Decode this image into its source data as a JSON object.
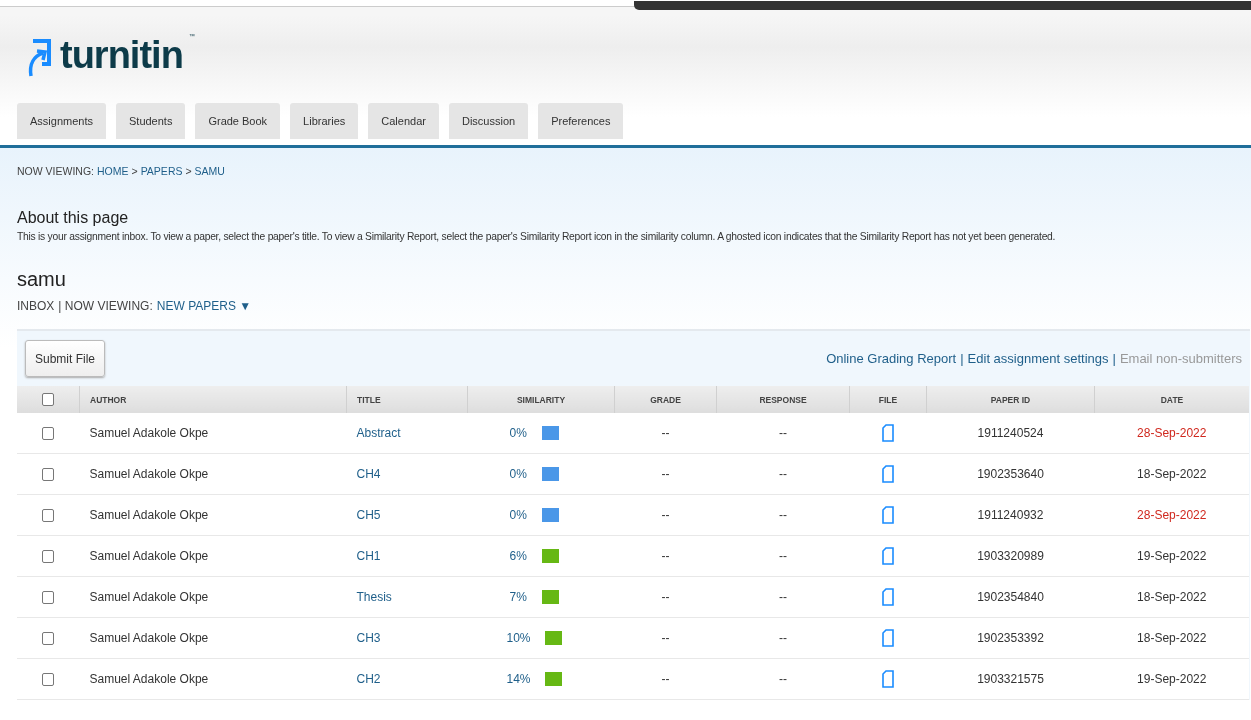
{
  "logo": {
    "text": "turnitin",
    "trademark": "™"
  },
  "tabs": [
    {
      "label": "Assignments",
      "selected": false
    },
    {
      "label": "Students",
      "selected": false
    },
    {
      "label": "Grade Book",
      "selected": false
    },
    {
      "label": "Libraries",
      "selected": false
    },
    {
      "label": "Calendar",
      "selected": false
    },
    {
      "label": "Discussion",
      "selected": false
    },
    {
      "label": "Preferences",
      "selected": false
    }
  ],
  "breadcrumb": {
    "prefix": "NOW VIEWING:",
    "links": [
      "HOME",
      "PAPERS",
      "SAMU"
    ],
    "separator": ">"
  },
  "about": {
    "heading": "About this page",
    "text": "This is your assignment inbox. To view a paper, select the paper's title. To view a Similarity Report, select the paper's Similarity Report icon in the similarity column. A ghosted icon indicates that the Similarity Report has not yet been generated."
  },
  "assignment": {
    "title": "samu",
    "inbox_label": "INBOX",
    "viewing_label": "| NOW VIEWING:",
    "viewing_value": "NEW PAPERS",
    "caret": "▼"
  },
  "toolbar": {
    "submit_button": "Submit File",
    "links": [
      {
        "label": "Online Grading Report",
        "disabled": false
      },
      {
        "label": "Edit assignment settings",
        "disabled": false
      },
      {
        "label": "Email non-submitters",
        "disabled": true
      }
    ],
    "separator": "|"
  },
  "table": {
    "columns": [
      "AUTHOR",
      "TITLE",
      "SIMILARITY",
      "GRADE",
      "RESPONSE",
      "FILE",
      "PAPER ID",
      "DATE"
    ],
    "header_checked": false,
    "rows": [
      {
        "checked": false,
        "author": "Samuel Adakole Okpe",
        "title": "Abstract",
        "similarity": "0%",
        "color": "#4a97e8",
        "grade": "--",
        "response": "--",
        "paper_id": "1911240524",
        "date": "28-Sep-2022",
        "date_highlighted": true
      },
      {
        "checked": false,
        "author": "Samuel Adakole Okpe",
        "title": "CH4",
        "similarity": "0%",
        "color": "#4a97e8",
        "grade": "--",
        "response": "--",
        "paper_id": "1902353640",
        "date": "18-Sep-2022",
        "date_highlighted": false
      },
      {
        "checked": false,
        "author": "Samuel Adakole Okpe",
        "title": "CH5",
        "similarity": "0%",
        "color": "#4a97e8",
        "grade": "--",
        "response": "--",
        "paper_id": "1911240932",
        "date": "28-Sep-2022",
        "date_highlighted": true
      },
      {
        "checked": false,
        "author": "Samuel Adakole Okpe",
        "title": "CH1",
        "similarity": "6%",
        "color": "#66b814",
        "grade": "--",
        "response": "--",
        "paper_id": "1903320989",
        "date": "19-Sep-2022",
        "date_highlighted": false
      },
      {
        "checked": false,
        "author": "Samuel Adakole Okpe",
        "title": "Thesis",
        "similarity": "7%",
        "color": "#66b814",
        "grade": "--",
        "response": "--",
        "paper_id": "1902354840",
        "date": "18-Sep-2022",
        "date_highlighted": false
      },
      {
        "checked": false,
        "author": "Samuel Adakole Okpe",
        "title": "CH3",
        "similarity": "10%",
        "color": "#66b814",
        "grade": "--",
        "response": "--",
        "paper_id": "1902353392",
        "date": "18-Sep-2022",
        "date_highlighted": false
      },
      {
        "checked": false,
        "author": "Samuel Adakole Okpe",
        "title": "CH2",
        "similarity": "14%",
        "color": "#66b814",
        "grade": "--",
        "response": "--",
        "paper_id": "1903321575",
        "date": "19-Sep-2022",
        "date_highlighted": false
      }
    ]
  }
}
